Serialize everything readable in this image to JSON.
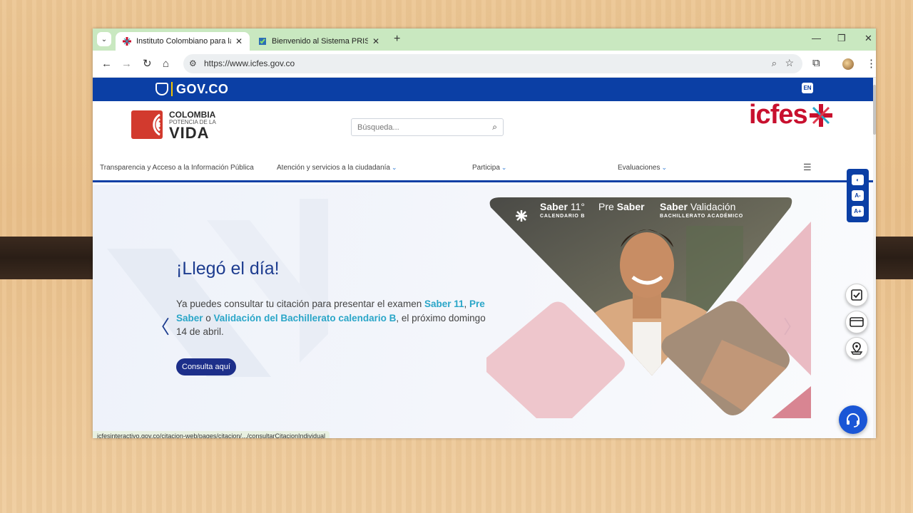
{
  "browser": {
    "tabs": [
      {
        "title": "Instituto Colombiano para la Ev",
        "active": true
      },
      {
        "title": "Bienvenido al Sistema PRISMA",
        "active": false
      }
    ],
    "tab_close": "✕",
    "new_tab": "+",
    "url": "https://www.icfes.gov.co",
    "window_controls": {
      "minimize": "—",
      "restore": "❐",
      "close": "✕"
    },
    "status_url": "icfesinteractivo.gov.co/citacion-web/pages/citacion/.../consultarCitacionIndividual"
  },
  "gov_bar": {
    "logo_text": "GOV.CO",
    "lang": "EN"
  },
  "header": {
    "brand_line1": "COLOMBIA",
    "brand_line2": "POTENCIA DE LA",
    "brand_line3": "VIDA",
    "search_placeholder": "Búsqueda...",
    "icfes_logo": "icfes"
  },
  "menu": {
    "items": [
      {
        "label": "Transparencia y Acceso a la Información Pública"
      },
      {
        "label": "Atención y servicios a la ciudadanía"
      },
      {
        "label": "Participa"
      },
      {
        "label": "Evaluaciones"
      }
    ]
  },
  "hero": {
    "title": "¡Llegó el día!",
    "desc_1": "Ya puedes consultar tu citación para presentar el examen ",
    "desc_hl_1": "Saber 11",
    "desc_2": ", ",
    "desc_hl_2": "Pre Saber",
    "desc_3": " o ",
    "desc_hl_3": "Validación del Bachillerato calendario B",
    "desc_4": ", el próximo domingo 14 de abril.",
    "cta": "Consulta aquí",
    "banner": {
      "saber11": "Saber",
      "saber11_num": "11°",
      "saber11_sub": "CALENDARIO B",
      "presaber_a": "Pre",
      "presaber_b": "Saber",
      "validacion_a": "Saber",
      "validacion_b": "Validación",
      "validacion_sub": "BACHILLERATO ACADÉMICO"
    }
  },
  "accessibility": {
    "contrast": "◐",
    "font_down": "A-",
    "font_up": "A+"
  },
  "colors": {
    "gov_blue": "#0b3fa5",
    "icfes_red": "#c8102e",
    "accent_teal": "#2aa6c8",
    "cta_navy": "#1d2f8a"
  }
}
